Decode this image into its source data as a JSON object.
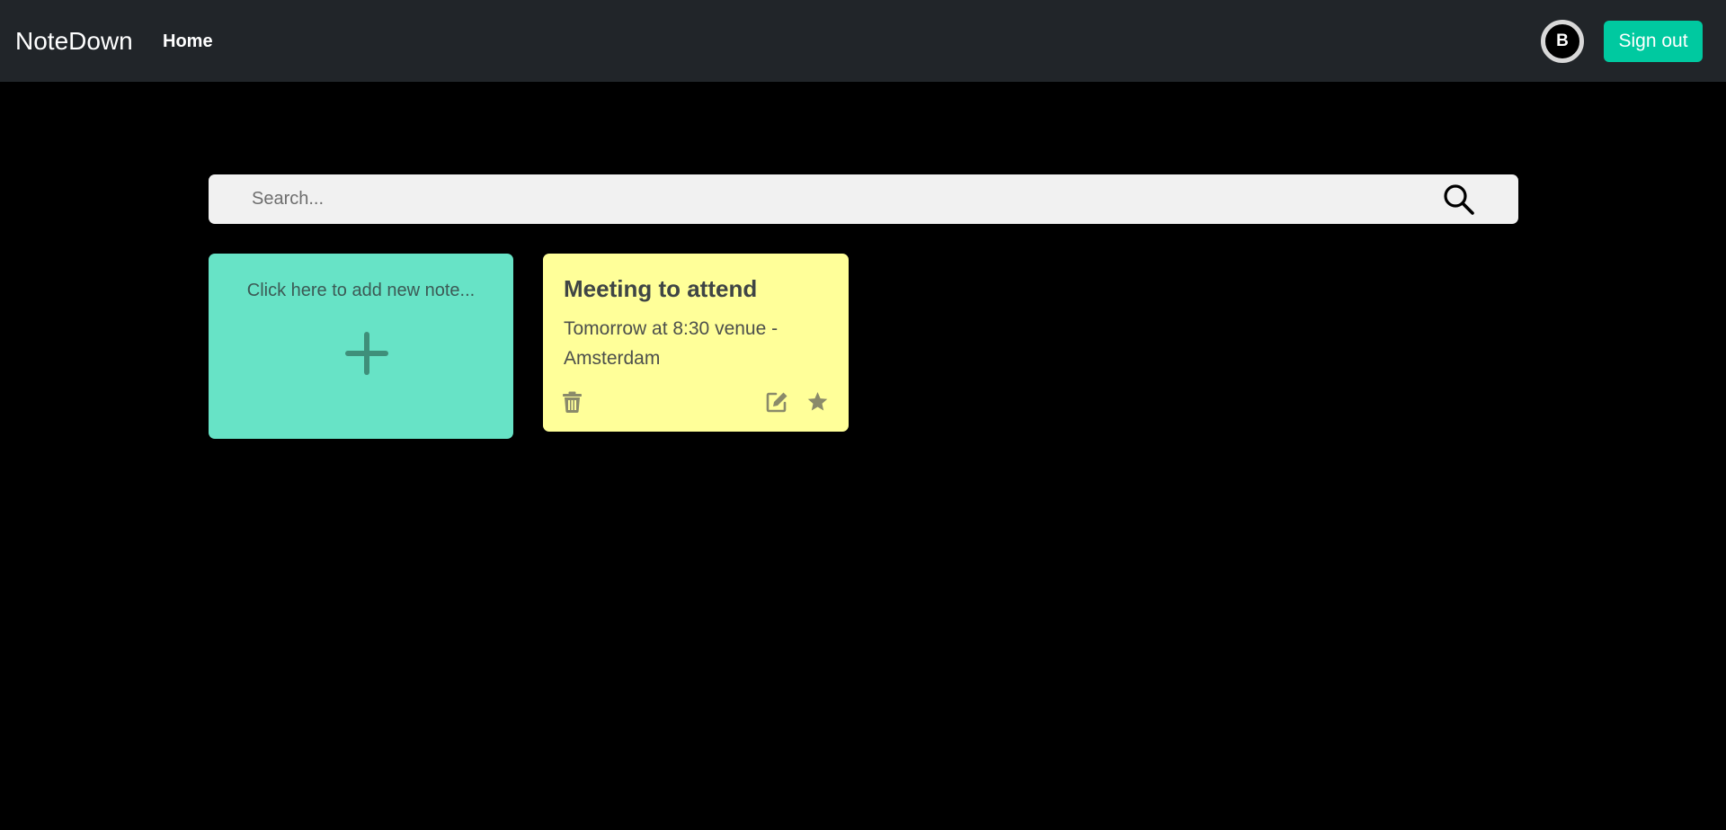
{
  "navbar": {
    "brand": "NoteDown",
    "home_label": "Home",
    "avatar_initial": "B",
    "signout_label": "Sign out"
  },
  "search": {
    "placeholder": "Search...",
    "value": "",
    "icon": "search-icon"
  },
  "add_card": {
    "label": "Click here to add new note...",
    "icon": "plus-icon"
  },
  "notes": [
    {
      "title": "Meeting to attend",
      "body": "Tomorrow at 8:30 venue - Amsterdam",
      "color": "#ffff99",
      "actions": [
        "trash-icon",
        "edit-icon",
        "star-icon"
      ]
    }
  ],
  "colors": {
    "navbar_bg": "#212529",
    "accent": "#00c9a0",
    "add_card_bg": "#67e3c6",
    "page_bg": "#000000"
  }
}
